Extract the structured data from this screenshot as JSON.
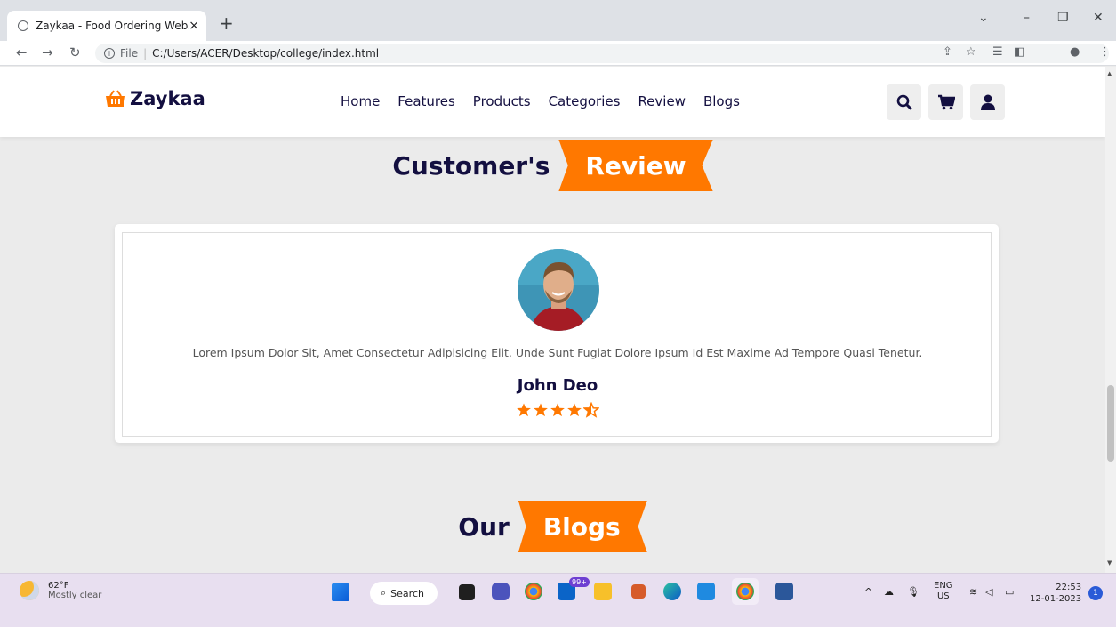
{
  "browser": {
    "tab_title": "Zaykaa - Food Ordering Website",
    "tab_close": "×",
    "new_tab": "+",
    "url_protocol": "File",
    "url_path": "C:/Users/ACER/Desktop/college/index.html"
  },
  "site": {
    "logo_text": "Zaykaa",
    "nav": [
      "Home",
      "Features",
      "Products",
      "Categories",
      "Review",
      "Blogs"
    ],
    "accent_color": "#ff7800",
    "text_color": "#130f40"
  },
  "review_section": {
    "heading_dark": "Customer's",
    "heading_highlight": "Review",
    "quote": "Lorem Ipsum Dolor Sit, Amet Consectetur Adipisicing Elit. Unde Sunt Fugiat Dolore Ipsum Id Est Maxime Ad Tempore Quasi Tenetur.",
    "reviewer_name": "John Deo",
    "rating": 4.5,
    "rating_max": 5
  },
  "blogs_section": {
    "heading_dark": "Our",
    "heading_highlight": "Blogs"
  },
  "taskbar": {
    "temperature": "62°F",
    "weather": "Mostly clear",
    "search_label": "Search",
    "mail_badge": "99+",
    "language_top": "ENG",
    "language_bottom": "US",
    "time": "22:53",
    "date": "12-01-2023",
    "notification_count": "1"
  }
}
